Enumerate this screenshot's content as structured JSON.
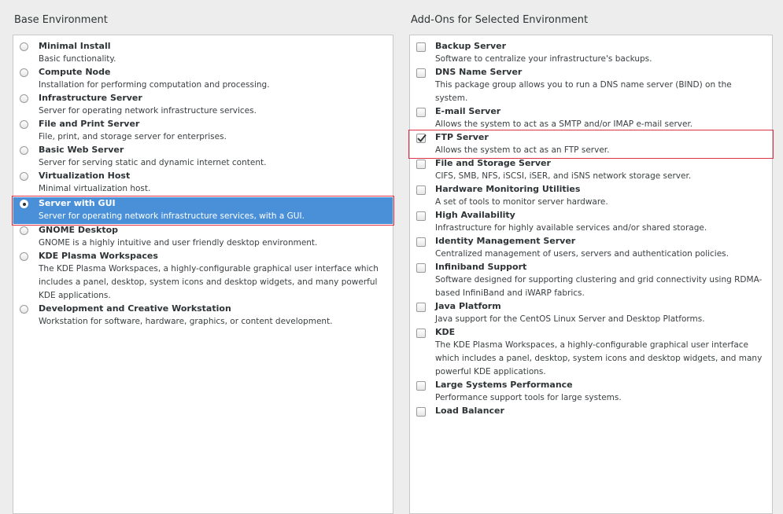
{
  "base": {
    "heading": "Base Environment",
    "items": [
      {
        "title": "Minimal Install",
        "desc": "Basic functionality."
      },
      {
        "title": "Compute Node",
        "desc": "Installation for performing computation and processing."
      },
      {
        "title": "Infrastructure Server",
        "desc": "Server for operating network infrastructure services."
      },
      {
        "title": "File and Print Server",
        "desc": "File, print, and storage server for enterprises."
      },
      {
        "title": "Basic Web Server",
        "desc": "Server for serving static and dynamic internet content."
      },
      {
        "title": "Virtualization Host",
        "desc": "Minimal virtualization host."
      },
      {
        "title": "Server with GUI",
        "desc": "Server for operating network infrastructure services, with a GUI."
      },
      {
        "title": "GNOME Desktop",
        "desc": "GNOME is a highly intuitive and user friendly desktop environment."
      },
      {
        "title": "KDE Plasma Workspaces",
        "desc": "The KDE Plasma Workspaces, a highly-configurable graphical user interface which includes a panel, desktop, system icons and desktop widgets, and many powerful KDE applications."
      },
      {
        "title": "Development and Creative Workstation",
        "desc": "Workstation for software, hardware, graphics, or content development."
      }
    ]
  },
  "addons": {
    "heading": "Add-Ons for Selected Environment",
    "items": [
      {
        "title": "Backup Server",
        "desc": "Software to centralize your infrastructure's backups."
      },
      {
        "title": "DNS Name Server",
        "desc": "This package group allows you to run a DNS name server (BIND) on the system."
      },
      {
        "title": "E-mail Server",
        "desc": "Allows the system to act as a SMTP and/or IMAP e-mail server."
      },
      {
        "title": "FTP Server",
        "desc": "Allows the system to act as an FTP server."
      },
      {
        "title": "File and Storage Server",
        "desc": "CIFS, SMB, NFS, iSCSI, iSER, and iSNS network storage server."
      },
      {
        "title": "Hardware Monitoring Utilities",
        "desc": "A set of tools to monitor server hardware."
      },
      {
        "title": "High Availability",
        "desc": "Infrastructure for highly available services and/or shared storage."
      },
      {
        "title": "Identity Management Server",
        "desc": "Centralized management of users, servers and authentication policies."
      },
      {
        "title": "Infiniband Support",
        "desc": "Software designed for supporting clustering and grid connectivity using RDMA-based InfiniBand and iWARP fabrics."
      },
      {
        "title": "Java Platform",
        "desc": "Java support for the CentOS Linux Server and Desktop Platforms."
      },
      {
        "title": "KDE",
        "desc": "The KDE Plasma Workspaces, a highly-configurable graphical user interface which includes a panel, desktop, system icons and desktop widgets, and many powerful KDE applications."
      },
      {
        "title": "Large Systems Performance",
        "desc": "Performance support tools for large systems."
      },
      {
        "title": "Load Balancer",
        "desc": ""
      }
    ]
  },
  "state": {
    "selected_environment_index": 6,
    "checked_addon_indices": [
      3
    ]
  },
  "colors": {
    "selection": "#4a90d9",
    "highlight_box": "#e0334a"
  }
}
